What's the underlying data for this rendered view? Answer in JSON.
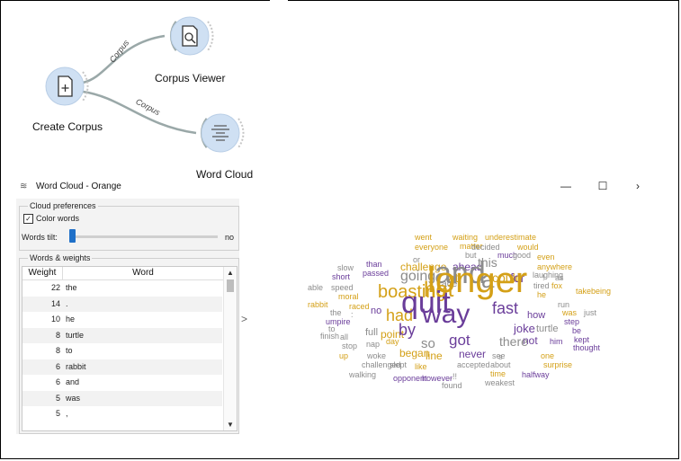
{
  "workflow": {
    "nodes": [
      {
        "label": "Create Corpus",
        "icon": "document-plus-icon"
      },
      {
        "label": "Corpus Viewer",
        "icon": "document-search-icon"
      },
      {
        "label": "Word Cloud",
        "icon": "word-cloud-icon"
      }
    ],
    "links": [
      "Corpus",
      "Corpus"
    ]
  },
  "window": {
    "title": "Word Cloud - Orange",
    "buttons": {
      "minimize": "—",
      "maximize": "☐",
      "close": "›"
    }
  },
  "cloud_preferences": {
    "title": "Cloud preferences",
    "color_words_label": "Color words",
    "color_words_checked": "✓",
    "tilt_label": "Words tilt:",
    "tilt_value": "no"
  },
  "words_weights": {
    "title": "Words & weights",
    "columns": [
      "Weight",
      "Word"
    ],
    "rows": [
      {
        "weight": "22",
        "word": "the"
      },
      {
        "weight": "14",
        "word": "."
      },
      {
        "weight": "10",
        "word": "he"
      },
      {
        "weight": "8",
        "word": "turtle"
      },
      {
        "weight": "8",
        "word": "to"
      },
      {
        "weight": "6",
        "word": "rabbit"
      },
      {
        "weight": "6",
        "word": "and"
      },
      {
        "weight": "5",
        "word": "was"
      },
      {
        "weight": "5",
        "word": ","
      }
    ]
  },
  "splitter_arrow": ">",
  "colors": {
    "purple": "#6a3d9a",
    "gold": "#d4a017",
    "gray": "#8c8c8c",
    "accent": "#1f70c8"
  },
  "cloud_words": [
    "went",
    "waiting",
    "underestimate",
    "matter",
    "everyone",
    "decided",
    "would",
    "but",
    "much",
    "good",
    "even",
    "or",
    "slow",
    "than",
    "challenge",
    "ahead",
    "this",
    "anywhere",
    "short",
    "passed",
    "laughing",
    "!",
    "as",
    "going",
    "race",
    "at",
    "could",
    "for",
    "tired",
    "fox",
    "able",
    "speed",
    "takebeing",
    "moral",
    "boasting",
    "hot",
    "and",
    "a",
    "he",
    "rabbit",
    "raced",
    "longer",
    "run",
    "the",
    ":",
    "no",
    "fast",
    "how",
    "was",
    "just",
    "umpire",
    "had",
    "quit",
    "step",
    "to",
    "way",
    "joke",
    "turtle",
    "be",
    "finish",
    "all",
    "full",
    "point",
    "by",
    "not",
    "him",
    "kept",
    "stop",
    "nap",
    "day",
    "so",
    "got",
    "thought",
    "up",
    "woke",
    "began",
    "line",
    "never",
    "see",
    "s",
    "one",
    "challenged",
    "slept",
    "like",
    "accepted",
    "about",
    "surprise",
    "walking",
    "opponent",
    "however",
    "..!!",
    "time",
    "halfway",
    "found",
    "weakest",
    "there",
    "of"
  ]
}
